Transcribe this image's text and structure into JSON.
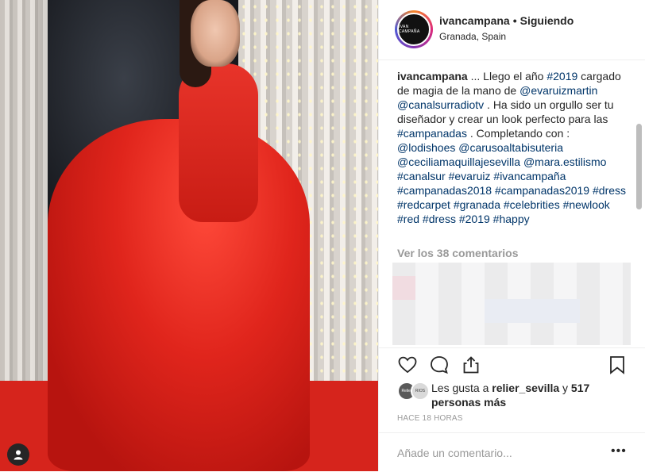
{
  "post": {
    "username": "ivancampana",
    "separator": "•",
    "follow_status": "Siguiendo",
    "location": "Granada, Spain",
    "avatar_text": "IVAN CAMPAÑA"
  },
  "caption": {
    "username": "ivancampana",
    "segments": [
      {
        "t": "text",
        "v": " ... Llego el año "
      },
      {
        "t": "tag",
        "v": "#2019"
      },
      {
        "t": "text",
        "v": " cargado de magia de la mano de "
      },
      {
        "t": "tag",
        "v": "@evaruizmartin"
      },
      {
        "t": "text",
        "v": " "
      },
      {
        "t": "tag",
        "v": "@canalsurradiotv"
      },
      {
        "t": "text",
        "v": " . Ha sido un orgullo ser tu diseñador y crear un look perfecto para las "
      },
      {
        "t": "tag",
        "v": "#campanadas"
      },
      {
        "t": "text",
        "v": " . Completando con : "
      },
      {
        "t": "tag",
        "v": "@lodishoes"
      },
      {
        "t": "text",
        "v": " "
      },
      {
        "t": "tag",
        "v": "@carusoaltabisuteria"
      },
      {
        "t": "text",
        "v": " "
      },
      {
        "t": "tag",
        "v": "@ceciliamaquillajesevilla"
      },
      {
        "t": "text",
        "v": " "
      },
      {
        "t": "tag",
        "v": "@mara.estilismo"
      },
      {
        "t": "text",
        "v": " "
      },
      {
        "t": "tag",
        "v": "#canalsur"
      },
      {
        "t": "text",
        "v": " "
      },
      {
        "t": "tag",
        "v": "#evaruiz"
      },
      {
        "t": "text",
        "v": " "
      },
      {
        "t": "tag",
        "v": "#ivancampaña"
      },
      {
        "t": "text",
        "v": " "
      },
      {
        "t": "tag",
        "v": "#campanadas2018"
      },
      {
        "t": "text",
        "v": " "
      },
      {
        "t": "tag",
        "v": "#campanadas2019"
      },
      {
        "t": "text",
        "v": " "
      },
      {
        "t": "tag",
        "v": "#dress"
      },
      {
        "t": "text",
        "v": " "
      },
      {
        "t": "tag",
        "v": "#redcarpet"
      },
      {
        "t": "text",
        "v": " "
      },
      {
        "t": "tag",
        "v": "#granada"
      },
      {
        "t": "text",
        "v": " "
      },
      {
        "t": "tag",
        "v": "#celebrities"
      },
      {
        "t": "text",
        "v": " "
      },
      {
        "t": "tag",
        "v": "#newlook"
      },
      {
        "t": "text",
        "v": " "
      },
      {
        "t": "tag",
        "v": "#red"
      },
      {
        "t": "text",
        "v": " "
      },
      {
        "t": "tag",
        "v": "#dress"
      },
      {
        "t": "text",
        "v": " "
      },
      {
        "t": "tag",
        "v": "#2019"
      },
      {
        "t": "text",
        "v": " "
      },
      {
        "t": "tag",
        "v": "#happy"
      }
    ]
  },
  "comments": {
    "view_all": "Ver los 38 comentarios"
  },
  "likes": {
    "prefix": "Les gusta a ",
    "user": "relier_sevilla",
    "middle": " y ",
    "others": "517 personas más",
    "avatar1_text": "Relier",
    "avatar2_text": "RIOS"
  },
  "time": "HACE 18 HORAS",
  "add_comment": {
    "placeholder": "Añade un comentario...",
    "more": "•••"
  },
  "icons": {
    "like": "heart-icon",
    "comment": "comment-icon",
    "share": "share-icon",
    "save": "bookmark-icon",
    "user_tags": "user-tag-icon"
  },
  "colors": {
    "hashtag": "#003569",
    "muted": "#999999",
    "text": "#262626"
  }
}
